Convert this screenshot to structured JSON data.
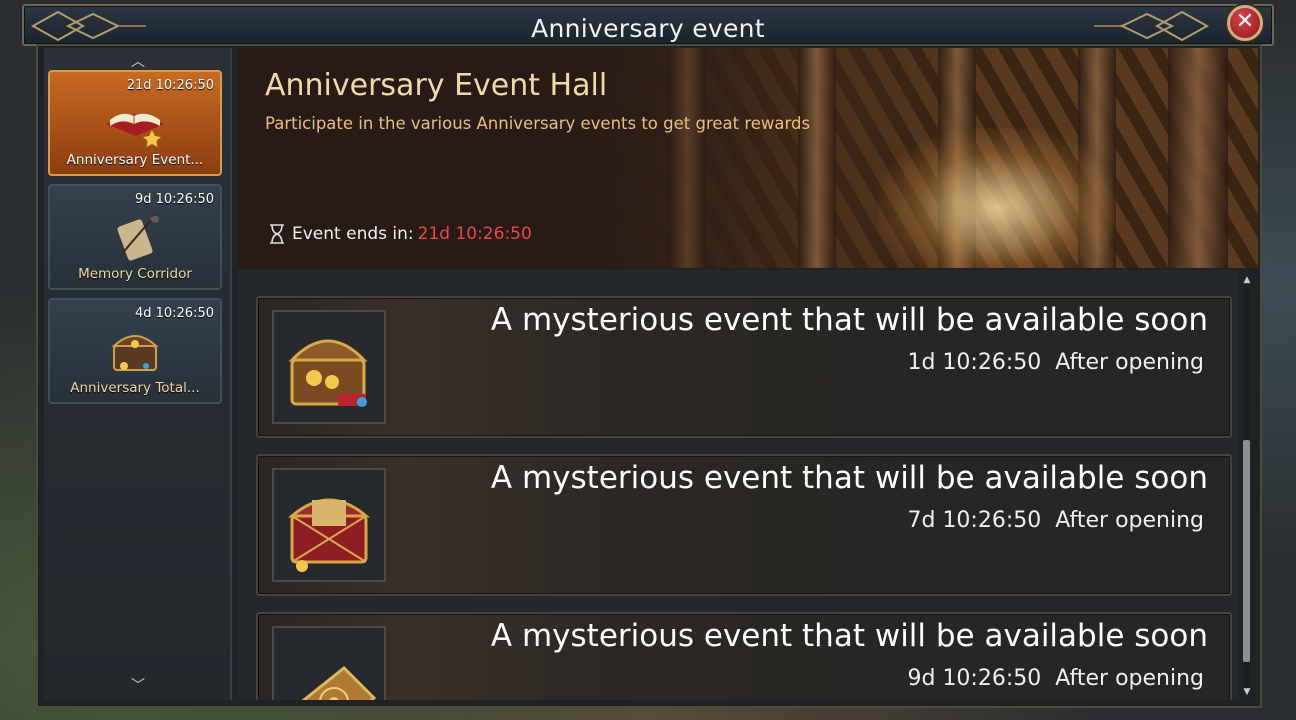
{
  "window": {
    "title": "Anniversary event",
    "close_icon": "close-icon"
  },
  "sidebar": {
    "items": [
      {
        "timer": "21d 10:26:50",
        "label": "Anniversary Event...",
        "icon": "book-icon",
        "active": true
      },
      {
        "timer": "9d 10:26:50",
        "label": "Memory Corridor",
        "icon": "scroll-quill-icon",
        "active": false
      },
      {
        "timer": "4d 10:26:50",
        "label": "Anniversary Total...",
        "icon": "treasure-chest-icon",
        "active": false
      }
    ]
  },
  "banner": {
    "title": "Anniversary Event Hall",
    "subtitle": "Participate in the various Anniversary events to get great rewards",
    "ends_label": "Event ends in:",
    "ends_value": "21d 10:26:50"
  },
  "events": [
    {
      "title": "A mysterious event that will be available soon",
      "timer": "1d 10:26:50",
      "suffix": "After opening",
      "icon": "treasure-chest-icon"
    },
    {
      "title": "A mysterious event that will be available soon",
      "timer": "7d 10:26:50",
      "suffix": "After opening",
      "icon": "gift-chest-icon"
    },
    {
      "title": "A mysterious event that will be available soon",
      "timer": "9d 10:26:50",
      "suffix": "After opening",
      "icon": "ornate-book-icon"
    }
  ],
  "colors": {
    "accent_orange": "#c86a22",
    "countdown_red": "#e8474c",
    "banner_title": "#f2d9a8",
    "banner_subtitle": "#e7c07a"
  }
}
